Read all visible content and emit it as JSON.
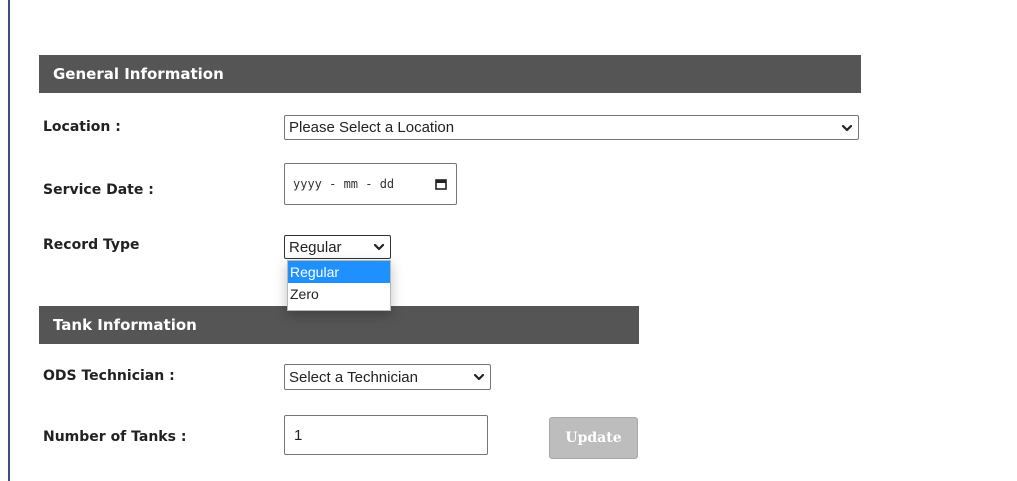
{
  "general_section": {
    "title": "General Information"
  },
  "location": {
    "label": "Location :",
    "selected": "Please Select a Location"
  },
  "service_date": {
    "label": "Service Date :",
    "placeholder": "yyyy - mm - dd"
  },
  "record_type": {
    "label": "Record Type",
    "selected": "Regular",
    "options": [
      {
        "label": "Regular",
        "selected": true
      },
      {
        "label": "Zero",
        "selected": false
      }
    ]
  },
  "tank_section": {
    "title": "Tank Information"
  },
  "technician": {
    "label": "ODS Technician :",
    "selected": "Select a Technician"
  },
  "tanks": {
    "label": "Number of Tanks :",
    "value": "1"
  },
  "update_button": {
    "label": "Update"
  },
  "colors": {
    "section_header": "#555555",
    "dropdown_highlight": "#1e90ff",
    "disabled_button": "#bdbdbd",
    "left_border": "#3a4f7a"
  },
  "icons": {
    "dropdown": "chevron-down-icon",
    "calendar": "calendar-icon"
  }
}
